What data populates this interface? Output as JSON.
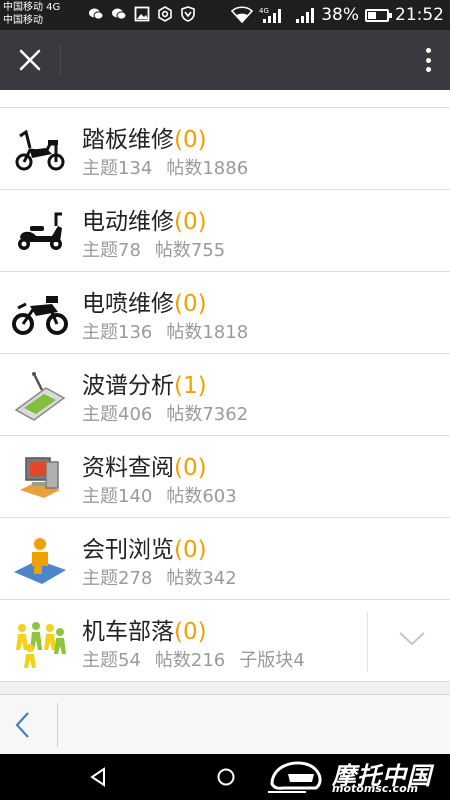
{
  "status_bar": {
    "carrier_1": "中国移动 4G",
    "carrier_2": "中国移动",
    "network": "4G",
    "battery": "38%",
    "battery_level": 0.38,
    "time": "21:52"
  },
  "forums": [
    {
      "title": "踏板维修",
      "unread": "(0)",
      "topics": "主题134",
      "posts": "帖数1886",
      "icon": "scooter-icon"
    },
    {
      "title": "电动维修",
      "unread": "(0)",
      "topics": "主题78",
      "posts": "帖数755",
      "icon": "electric-scooter-icon"
    },
    {
      "title": "电喷维修",
      "unread": "(0)",
      "topics": "主题136",
      "posts": "帖数1818",
      "icon": "motorcycle-icon"
    },
    {
      "title": "波谱分析",
      "unread": "(1)",
      "topics": "主题406",
      "posts": "帖数7362",
      "icon": "handheld-device-icon"
    },
    {
      "title": "资料查阅",
      "unread": "(0)",
      "topics": "主题140",
      "posts": "帖数603",
      "icon": "computer-icon"
    },
    {
      "title": "会刊浏览",
      "unread": "(0)",
      "topics": "主题278",
      "posts": "帖数342",
      "icon": "reader-icon"
    },
    {
      "title": "机车部落",
      "unread": "(0)",
      "topics": "主题54",
      "posts": "帖数216",
      "subforums": "子版块4",
      "icon": "people-group-icon"
    }
  ],
  "watermark": {
    "text": "摩托中国",
    "url": "motomsc.com"
  },
  "colors": {
    "top_bar": "#393a3f",
    "unread": "#f0a000",
    "stats": "#9a9a9a",
    "back_button": "#4a7cc4"
  }
}
